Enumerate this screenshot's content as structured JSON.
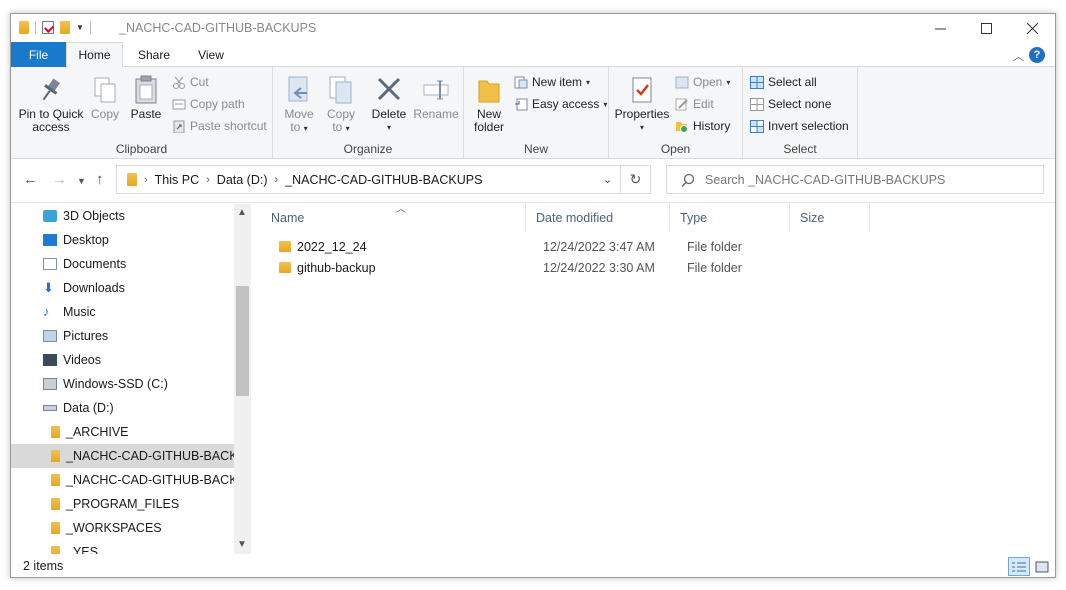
{
  "window": {
    "title": "_NACHC-CAD-GITHUB-BACKUPS"
  },
  "ribbon_tabs": [
    "File",
    "Home",
    "Share",
    "View"
  ],
  "ribbon": {
    "clipboard": {
      "label": "Clipboard",
      "pin_line1": "Pin to Quick",
      "pin_line2": "access",
      "copy": "Copy",
      "paste": "Paste",
      "cut": "Cut",
      "copy_path": "Copy path",
      "paste_shortcut": "Paste shortcut"
    },
    "organize": {
      "label": "Organize",
      "move_to_line1": "Move",
      "move_to_line2": "to",
      "copy_to_line1": "Copy",
      "copy_to_line2": "to",
      "delete": "Delete",
      "rename": "Rename"
    },
    "new": {
      "label": "New",
      "new_folder_line1": "New",
      "new_folder_line2": "folder",
      "new_item": "New item",
      "easy_access": "Easy access"
    },
    "open": {
      "label": "Open",
      "properties": "Properties",
      "open": "Open",
      "edit": "Edit",
      "history": "History"
    },
    "select": {
      "label": "Select",
      "select_all": "Select all",
      "select_none": "Select none",
      "invert_selection": "Invert selection"
    }
  },
  "address": {
    "crumbs": [
      "This PC",
      "Data (D:)",
      "_NACHC-CAD-GITHUB-BACKUPS"
    ],
    "search_placeholder": "Search _NACHC-CAD-GITHUB-BACKUPS"
  },
  "nav": {
    "items": [
      {
        "label": "3D Objects",
        "icon": "3d-objects-icon"
      },
      {
        "label": "Desktop",
        "icon": "desktop-icon"
      },
      {
        "label": "Documents",
        "icon": "documents-icon"
      },
      {
        "label": "Downloads",
        "icon": "downloads-icon"
      },
      {
        "label": "Music",
        "icon": "music-icon"
      },
      {
        "label": "Pictures",
        "icon": "pictures-icon"
      },
      {
        "label": "Videos",
        "icon": "videos-icon"
      },
      {
        "label": "Windows-SSD (C:)",
        "icon": "drive-c-icon"
      },
      {
        "label": "Data (D:)",
        "icon": "drive-d-icon"
      },
      {
        "label": "_ARCHIVE",
        "icon": "folder-icon"
      },
      {
        "label": "_NACHC-CAD-GITHUB-BACKUPS",
        "icon": "folder-icon",
        "selected": true
      },
      {
        "label": "_NACHC-CAD-GITHUB-BACKUPS",
        "icon": "folder-icon"
      },
      {
        "label": "_PROGRAM_FILES",
        "icon": "folder-icon"
      },
      {
        "label": "_WORKSPACES",
        "icon": "folder-icon"
      },
      {
        "label": "_YES",
        "icon": "folder-icon"
      }
    ]
  },
  "columns": {
    "name": "Name",
    "date_modified": "Date modified",
    "type": "Type",
    "size": "Size"
  },
  "files": [
    {
      "name": "2022_12_24",
      "date": "12/24/2022 3:47 AM",
      "type": "File folder",
      "size": ""
    },
    {
      "name": "github-backup",
      "date": "12/24/2022 3:30 AM",
      "type": "File folder",
      "size": ""
    }
  ],
  "status": {
    "items_count": "2 items"
  },
  "colors": {
    "accent": "#1979ca",
    "folder": "#e8b02a",
    "selected": "#d9d9d9"
  }
}
